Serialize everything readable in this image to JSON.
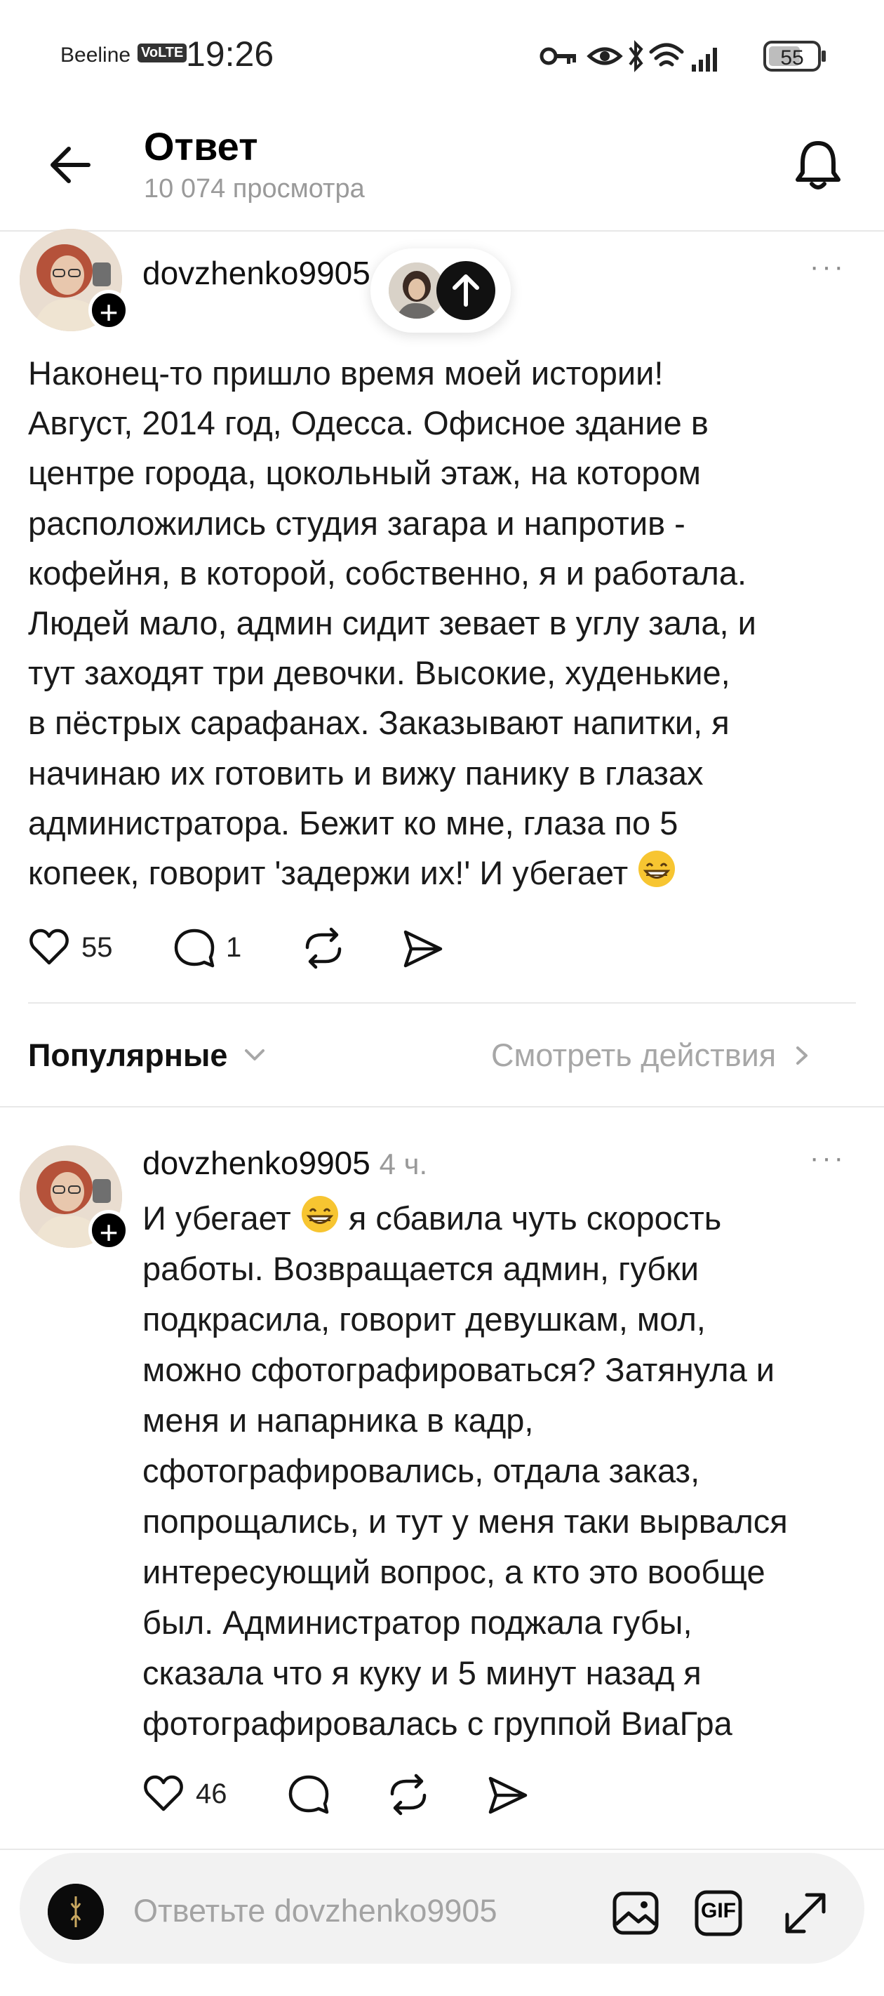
{
  "status_bar": {
    "carrier": "Beeline",
    "volte": "VoLTE",
    "time": "19:26",
    "battery": "55"
  },
  "header": {
    "title": "Ответ",
    "subtitle": "10 074 просмотра"
  },
  "post": {
    "author": "dovzhenko9905",
    "text": "Наконец-то пришло время моей истории!\nАвгуст, 2014 год, Одесса. Офисное здание в\nцентре города, цокольный этаж, на котором\nрасположились студия загара и напротив -\nкофейня, в которой, собственно, я и работала.\nЛюдей мало, админ сидит зевает в углу зала, и\nтут заходят три девочки. Высокие, худенькие,\nв пёстрых сарафанах. Заказывают напитки, я\nначинаю их готовить и вижу панику в глазах\nадминистратора. Бежит ко мне, глаза по 5\nкопеек, говорит 'задержи их!' И убегает",
    "likes": "55",
    "comments": "1"
  },
  "sort_bar": {
    "sort_label": "Популярные",
    "view_activity": "Смотреть действия"
  },
  "reply": {
    "author": "dovzhenko9905",
    "time_ago": "4 ч.",
    "text_start": "И убегает",
    "text_rest": " я сбавила чуть скорость\nработы. Возвращается админ, губки\nподкрасила, говорит девушкам, мол,\nможно сфотографироваться? Затянула и\nменя и напарника в кадр,\nсфотографировались,  отдала заказ,\nпопрощались, и тут у меня таки вырвался\nинтересующий вопрос, а кто это вообще\nбыл. Администратор поджала губы,\nсказала что я куку и 5 минут назад я\nфотографировалась с группой ВиаГра",
    "likes": "46"
  },
  "composer": {
    "placeholder": "Ответьте dovzhenko9905",
    "gif_label": "GIF"
  },
  "colors": {
    "muted_text": "#9a9a9a",
    "divider": "#e8e8e8",
    "composer_bg": "#f2f2f2"
  }
}
